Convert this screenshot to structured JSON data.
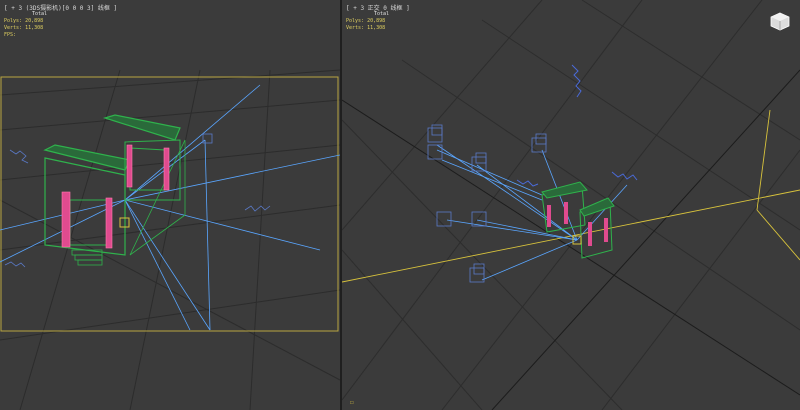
{
  "viewports": {
    "left": {
      "label": "[ + 3 (3DS摄影机)[0 0 0 3] 线框 ]",
      "stats_total": "Total",
      "stats_polys": "Polys: 20,898",
      "stats_verts": "Verts: 11,308",
      "fps": "FPS:"
    },
    "right": {
      "label": "[ + 3 正交 0 线框 ]",
      "stats_total": "Total",
      "stats_polys": "Polys: 20,898",
      "stats_verts": "Verts: 11,308",
      "corner": "☐"
    }
  },
  "icons": {
    "viewcube": "viewcube-icon",
    "camera": "camera-icon",
    "light": "light-icon"
  },
  "colors": {
    "background": "#3b3b3b",
    "grid": "#2e2e2e",
    "wire_green": "#2fb24c",
    "wire_pink": "#e04b8f",
    "wire_blue": "#5a7ac8",
    "light_blue": "#5aa6ff",
    "yellow": "#d8c33c"
  }
}
